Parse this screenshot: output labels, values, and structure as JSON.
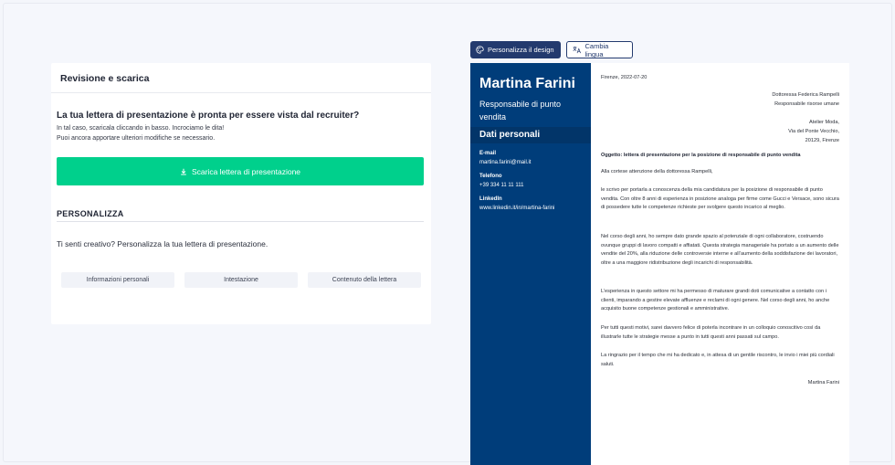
{
  "panel": {
    "header": "Revisione e scarica",
    "ready_title": "La tua lettera di presentazione è pronta per essere vista dal recruiter?",
    "ready_line1": "In tal caso, scaricala cliccando in basso. Incrociamo le dita!",
    "ready_line2": "Puoi ancora apportare ulteriori modifiche se necessario.",
    "download_label": "Scarica lettera di presentazione",
    "customize_title": "PERSONALIZZA",
    "customize_text": "Ti senti creativo? Personalizza la tua lettera di presentazione.",
    "tabs": [
      "Informazioni personali",
      "Intestazione",
      "Contenuto della lettera"
    ]
  },
  "toolbar": {
    "design_label": "Personalizza il design",
    "language_label": "Cambia lingua"
  },
  "colors": {
    "sidebar": "#003d7a",
    "accent": "#00d08c",
    "button": "#233a6e"
  },
  "letter": {
    "name": "Martina Farini",
    "role": "Responsabile di punto vendita",
    "personal_title": "Dati personali",
    "email_label": "E-mail",
    "email": "martina.farini@mail.it",
    "phone_label": "Telefono",
    "phone": "+39 334 11 11 111",
    "linkedin_label": "LinkedIn",
    "linkedin": "www.linkedin.it/in/martina-farini",
    "date": "Firenze, 2022-07-20",
    "recipient_name": "Dottoressa Federica Rampelli",
    "recipient_role": "Responsabile risorse umane",
    "company": "Atelier Moda,",
    "street": "Via del Ponte Vecchio,",
    "city": "20129, Firenze",
    "subject": "Oggetto: lettera di presentazione per la posizione di responsabile di punto vendita",
    "greeting": "Alla cortese attenzione della dottoressa Rampelli,",
    "p1": "le scrivo per portarla a conoscenza della mia candidatura per la posizione di responsabile di punto vendita. Con oltre 8 anni di esperienza in posizione analoga per firme come Gucci e Versace, sono sicura di possedere tutte le competenze richieste per svolgere questo incarico al meglio.",
    "p2": "Nel corso degli anni, ho sempre dato grande spazio al potenziale di ogni collaboratore, costruendo ovunque gruppi di lavoro compatti e affiatati. Questa strategia manageriale ha portato a un aumento delle vendite del 20%, alla riduzione delle controversie interne e all’aumento della soddisfazione dei lavoratori, oltre a una maggiore ridistribuzione degli incarichi di responsabilità.",
    "p3": "L’esperienza in questo settore mi ha permesso di maturare grandi doti comunicative a contatto con i clienti, imparando a gestire elevate affluenze e reclami di ogni genere. Nel corso degli anni, ho anche acquisito buone competenze gestionali e amministrative.",
    "p4": "Per tutti questi motivi, sarei davvero felice di poterla incontrare in un colloquio conoscitivo così da illustrarle tutte le strategie messe a punto in tutti questi anni passati sul campo.",
    "p5": "La ringrazio per il tempo che mi ha dedicato e, in attesa di un gentile riscontro, le invio i miei più cordiali saluti.",
    "signature": "Martina Farini"
  }
}
